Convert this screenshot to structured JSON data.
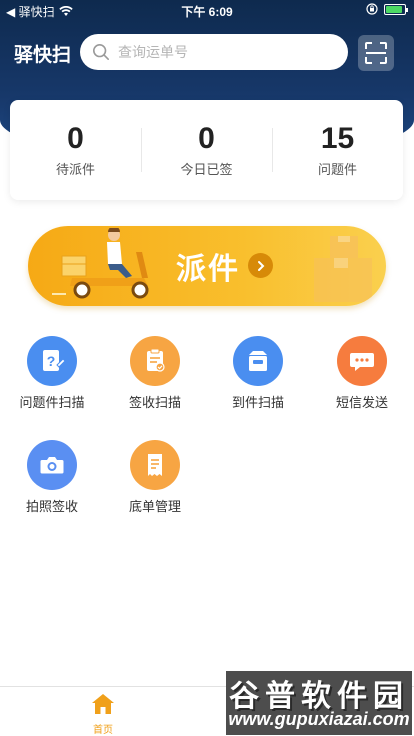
{
  "status_bar": {
    "carrier": "◀ 驿快扫",
    "time": "下午 6:09"
  },
  "header": {
    "app_title": "驿快扫",
    "search_placeholder": "查询运单号"
  },
  "stats": [
    {
      "value": "0",
      "label": "待派件"
    },
    {
      "value": "0",
      "label": "今日已签"
    },
    {
      "value": "15",
      "label": "问题件"
    }
  ],
  "dispatch": {
    "label": "派件"
  },
  "menu": [
    {
      "label": "问题件扫描",
      "icon": "question-doc-icon",
      "color": "#4a8ef0"
    },
    {
      "label": "签收扫描",
      "icon": "sign-doc-icon",
      "color": "#f7a543"
    },
    {
      "label": "到件扫描",
      "icon": "package-box-icon",
      "color": "#4a8ef0"
    },
    {
      "label": "短信发送",
      "icon": "message-icon",
      "color": "#f67c3e"
    },
    {
      "label": "拍照签收",
      "icon": "camera-icon",
      "color": "#5a8ff2"
    },
    {
      "label": "底单管理",
      "icon": "receipt-icon",
      "color": "#f7a543"
    }
  ],
  "tab_bar": {
    "home_label": "首页",
    "accent": "#f0a01a"
  },
  "watermark": {
    "title": "谷普软件园",
    "url": "www.gupuxiazai.com"
  }
}
